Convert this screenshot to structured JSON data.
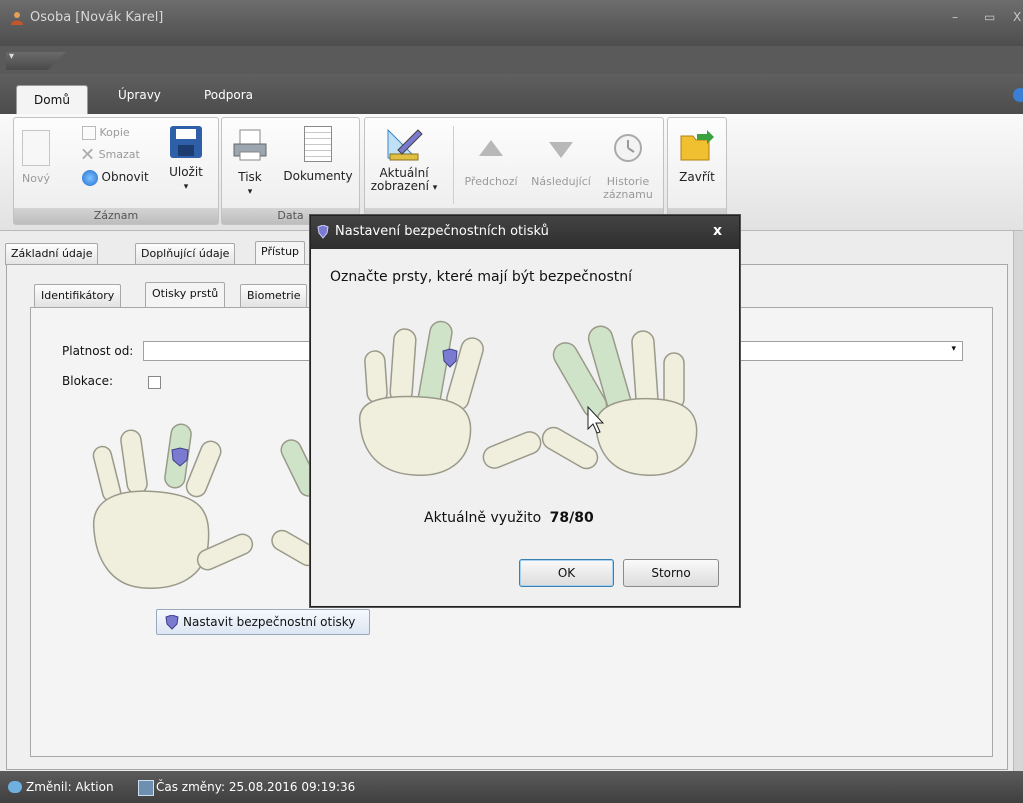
{
  "window": {
    "title": "Osoba [Novák Karel]",
    "minimize": "–",
    "maximize": "▭",
    "close": "X"
  },
  "ribbon_tabs": [
    "Domů",
    "Úpravy",
    "Podpora"
  ],
  "ribbon": {
    "zaznam": {
      "label": "Záznam",
      "new": "Nový",
      "copy": "Kopie",
      "delete": "Smazat",
      "refresh": "Obnovit",
      "save": "Uložit"
    },
    "data": {
      "label": "Data",
      "print": "Tisk",
      "documents": "Dokumenty"
    },
    "view": {
      "current_view_1": "Aktuální",
      "current_view_2": "zobrazení",
      "previous": "Předchozí",
      "next": "Následující",
      "history_1": "Historie",
      "history_2": "záznamu"
    },
    "close": {
      "label": "Zavřít"
    }
  },
  "content_tabs": [
    "Základní údaje",
    "Doplňující údaje",
    "Přístup"
  ],
  "inner_tabs": [
    "Identifikátory",
    "Otisky prstů",
    "Biometrie"
  ],
  "form": {
    "valid_from_label": "Platnost od:",
    "block_label": "Blokace:",
    "blocked": false,
    "set_secure_button": "Nastavit bezpečnostní otisky"
  },
  "dialog": {
    "title": "Nastavení bezpečnostních otisků",
    "close": "x",
    "instruction": "Označte prsty, které mají být bezpečnostní",
    "usage_label": "Aktuálně využito",
    "usage_value": "78/80",
    "ok": "OK",
    "cancel": "Storno"
  },
  "status": {
    "changed_by": "Změnil: Aktion",
    "changed_at": "Čas změny: 25.08.2016 09:19:36"
  },
  "colors": {
    "finger": "#f0eedd",
    "finger_selected": "#cfe3c8",
    "finger_outline": "#9a9a8a",
    "ribbon_dark": "#4d4d4d",
    "ok_border": "#3c7fb1"
  },
  "icons": [
    "person-icon",
    "new-doc-icon",
    "copy-icon",
    "delete-icon",
    "refresh-icon",
    "save-icon",
    "printer-icon",
    "document-icon",
    "ruler-pencil-icon",
    "up-arrow-icon",
    "down-arrow-icon",
    "clock-icon",
    "folder-exit-icon",
    "shield-icon",
    "cursor-icon"
  ]
}
